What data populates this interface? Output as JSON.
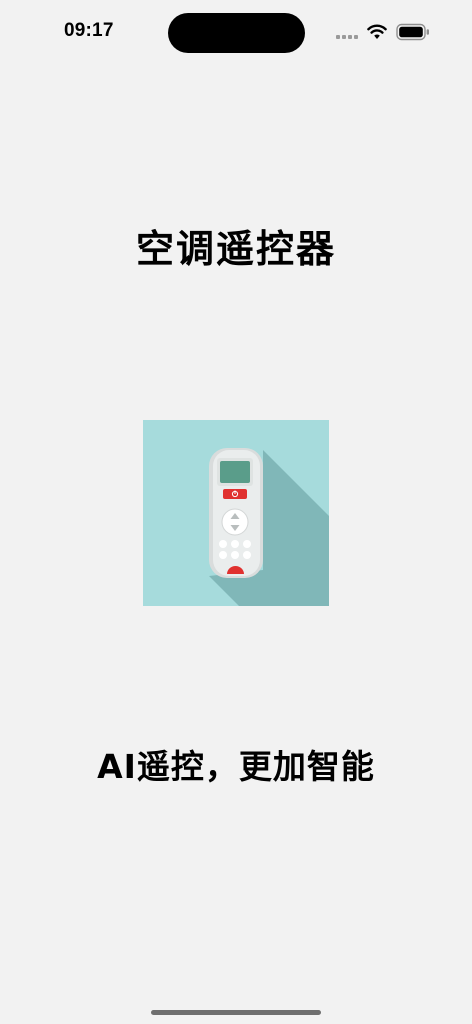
{
  "status_bar": {
    "time": "09:17",
    "signal_icon": "cellular-signal-icon",
    "wifi_icon": "wifi-icon",
    "battery_icon": "battery-icon"
  },
  "splash": {
    "title": "空调遥控器",
    "logo_icon": "air-conditioner-remote-icon",
    "slogan": "AI遥控，更加智能"
  },
  "colors": {
    "background": "#f2f2f2",
    "logo_background": "#a6dbdc",
    "logo_shadow": "#80b7b8",
    "remote_screen": "#5a9d8a",
    "remote_red": "#e0312f"
  }
}
